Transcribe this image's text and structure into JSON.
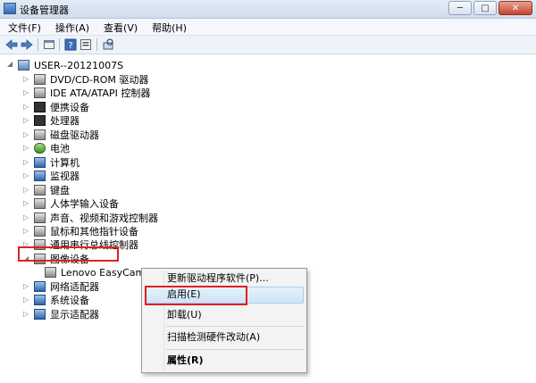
{
  "window": {
    "title": "设备管理器",
    "minimize_glyph": "─",
    "maximize_glyph": "□",
    "close_glyph": "✕"
  },
  "menu": [
    "文件(F)",
    "操作(A)",
    "查看(V)",
    "帮助(H)"
  ],
  "toolbar_icons": [
    "back-arrow-icon",
    "forward-arrow-icon",
    "properties-icon",
    "help-icon",
    "scan-hardware-icon"
  ],
  "tree": {
    "root": "USER--20121007S",
    "expanded_glyph": "◢",
    "collapsed_glyph": "▷",
    "categories": [
      {
        "label": "DVD/CD-ROM 驱动器",
        "icon": "dvd-drive-icon"
      },
      {
        "label": "IDE ATA/ATAPI 控制器",
        "icon": "ide-controller-icon"
      },
      {
        "label": "便携设备",
        "icon": "portable-device-icon"
      },
      {
        "label": "处理器",
        "icon": "processor-icon"
      },
      {
        "label": "磁盘驱动器",
        "icon": "disk-drive-icon"
      },
      {
        "label": "电池",
        "icon": "battery-icon"
      },
      {
        "label": "计算机",
        "icon": "computer-icon"
      },
      {
        "label": "监视器",
        "icon": "monitor-icon"
      },
      {
        "label": "键盘",
        "icon": "keyboard-icon"
      },
      {
        "label": "人体学输入设备",
        "icon": "hid-icon"
      },
      {
        "label": "声音、视频和游戏控制器",
        "icon": "speaker-icon"
      },
      {
        "label": "鼠标和其他指针设备",
        "icon": "mouse-icon"
      },
      {
        "label": "通用串行总线控制器",
        "icon": "usb-icon"
      },
      {
        "label": "图像设备",
        "icon": "imaging-device-icon",
        "expanded": true
      },
      {
        "label": "Lenovo EasyCamera",
        "icon": "camera-icon",
        "child": true
      },
      {
        "label": "网络适配器",
        "icon": "network-adapter-icon"
      },
      {
        "label": "系统设备",
        "icon": "system-device-icon"
      },
      {
        "label": "显示适配器",
        "icon": "display-adapter-icon"
      }
    ]
  },
  "context_menu": {
    "items": [
      {
        "label": "更新驱动程序软件(P)...",
        "bold": false
      },
      {
        "label": "启用(E)",
        "bold": false,
        "hovered": true
      },
      {
        "label": "卸载(U)",
        "bold": false
      },
      {
        "label": "扫描检测硬件改动(A)",
        "bold": false
      },
      {
        "label": "属性(R)",
        "bold": true
      }
    ]
  },
  "colors": {
    "highlight_border": "#e02020",
    "menu_hover": "#cfe4f7"
  }
}
